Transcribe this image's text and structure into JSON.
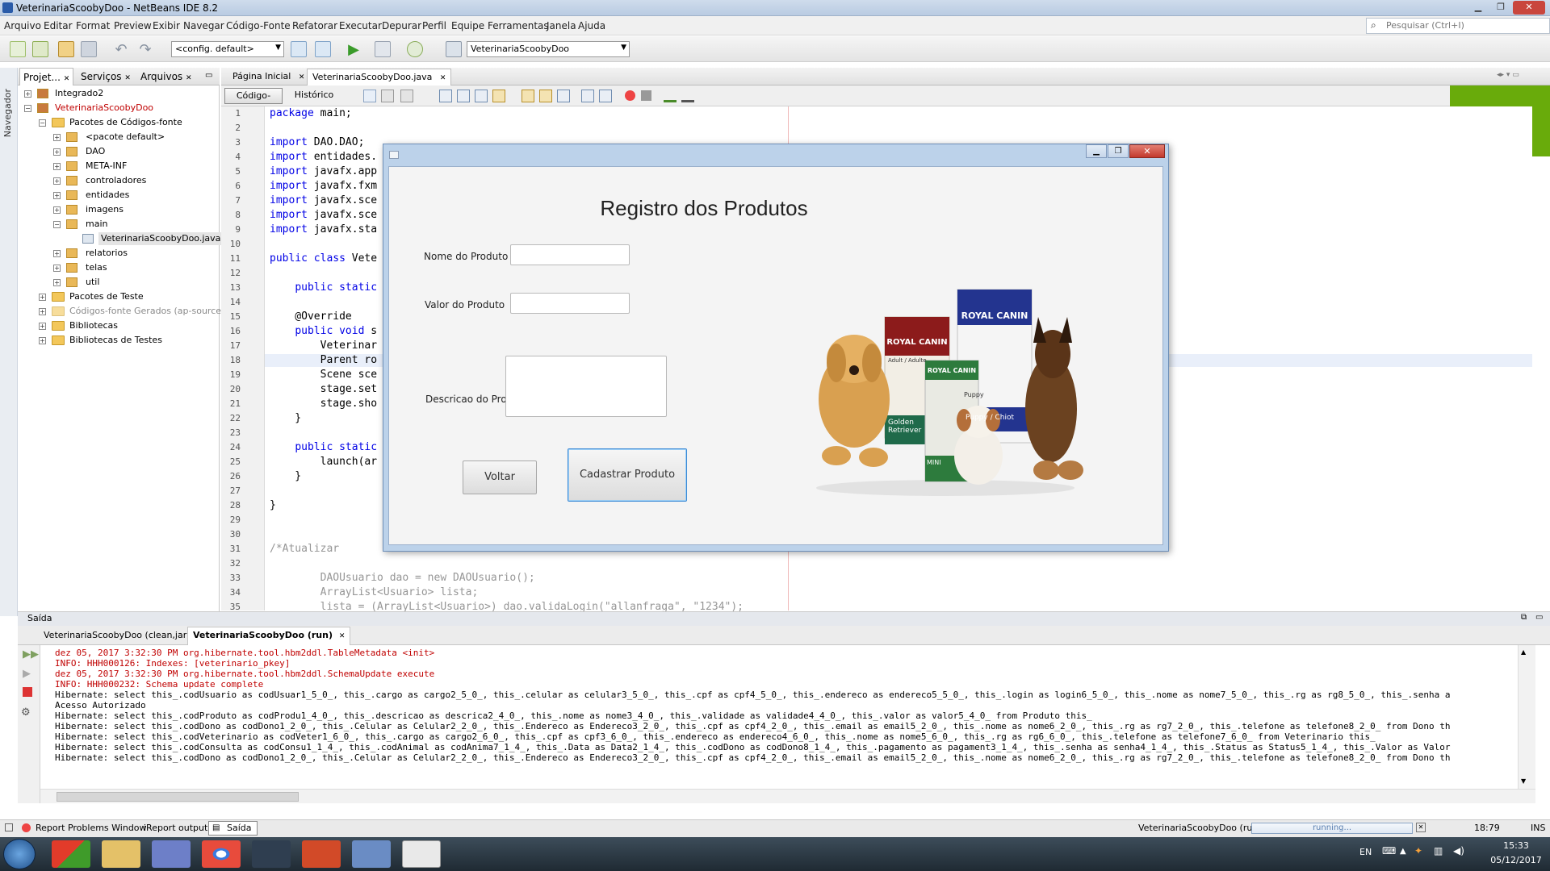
{
  "window": {
    "title": "VeterinariaScoobyDoo - NetBeans IDE 8.2"
  },
  "menu": [
    "Arquivo",
    "Editar",
    "Format",
    "Preview",
    "Exibir",
    "Navegar",
    "Código-Fonte",
    "Refatorar",
    "Executar",
    "Depurar",
    "Perfil",
    "Equipe",
    "Ferramentas",
    "Janela",
    "Ajuda"
  ],
  "search": {
    "placeholder": "Pesquisar (Ctrl+I)"
  },
  "toolbar": {
    "config_combo": "<config. default>",
    "project_combo": "VeterinariaScoobyDoo"
  },
  "navigator_label": "Navegador",
  "project_tabs": [
    "Projet...",
    "Serviços",
    "Arquivos"
  ],
  "tree": [
    {
      "label": "Integrado2"
    },
    {
      "label": "VeterinariaScoobyDoo"
    },
    {
      "label": "Pacotes de Códigos-fonte"
    },
    {
      "label": "<pacote default>"
    },
    {
      "label": "DAO"
    },
    {
      "label": "META-INF"
    },
    {
      "label": "controladores"
    },
    {
      "label": "entidades"
    },
    {
      "label": "imagens"
    },
    {
      "label": "main"
    },
    {
      "label": "VeterinariaScoobyDoo.java"
    },
    {
      "label": "relatorios"
    },
    {
      "label": "telas"
    },
    {
      "label": "util"
    },
    {
      "label": "Pacotes de Teste"
    },
    {
      "label": "Códigos-fonte Gerados (ap-source-out"
    },
    {
      "label": "Bibliotecas"
    },
    {
      "label": "Bibliotecas de Testes"
    }
  ],
  "editor_tabs": [
    "Página Inicial",
    "VeterinariaScoobyDoo.java"
  ],
  "editor_subtabs": [
    "Código-Fonte",
    "Histórico"
  ],
  "code_lines": [
    {
      "n": "1",
      "text": "package main;"
    },
    {
      "n": "2",
      "text": ""
    },
    {
      "n": "3",
      "text": "import DAO.DAO;"
    },
    {
      "n": "4",
      "text": "import entidades."
    },
    {
      "n": "5",
      "text": "import javafx.app"
    },
    {
      "n": "6",
      "text": "import javafx.fxm"
    },
    {
      "n": "7",
      "text": "import javafx.sce"
    },
    {
      "n": "8",
      "text": "import javafx.sce"
    },
    {
      "n": "9",
      "text": "import javafx.sta"
    },
    {
      "n": "10",
      "text": ""
    },
    {
      "n": "11",
      "text": "public class Vete"
    },
    {
      "n": "12",
      "text": ""
    },
    {
      "n": "13",
      "text": "    public static"
    },
    {
      "n": "14",
      "text": ""
    },
    {
      "n": "15",
      "text": "    @Override"
    },
    {
      "n": "16",
      "text": "    public void s"
    },
    {
      "n": "17",
      "text": "        Veterinar"
    },
    {
      "n": "18",
      "text": "        Parent ro"
    },
    {
      "n": "19",
      "text": "        Scene sce"
    },
    {
      "n": "20",
      "text": "        stage.set"
    },
    {
      "n": "21",
      "text": "        stage.sho"
    },
    {
      "n": "22",
      "text": "    }"
    },
    {
      "n": "23",
      "text": ""
    },
    {
      "n": "24",
      "text": "    public static"
    },
    {
      "n": "25",
      "text": "        launch(ar"
    },
    {
      "n": "26",
      "text": "    }"
    },
    {
      "n": "27",
      "text": ""
    },
    {
      "n": "28",
      "text": "}"
    },
    {
      "n": "29",
      "text": ""
    },
    {
      "n": "30",
      "text": ""
    },
    {
      "n": "31",
      "text": "/*Atualizar"
    },
    {
      "n": "32",
      "text": ""
    },
    {
      "n": "33",
      "text": "        DAOUsuario dao = new DAOUsuario();"
    },
    {
      "n": "34",
      "text": "        ArrayList<Usuario> lista;"
    },
    {
      "n": "35",
      "text": "        lista = (ArrayList<Usuario>) dao.validaLogin(\"allanfraga\", \"1234\");"
    }
  ],
  "dialog": {
    "title": "Registro dos Produtos",
    "label_nome": "Nome do Produto",
    "label_valor": "Valor do Produto",
    "label_descricao": "Descricao do Produto",
    "btn_voltar": "Voltar",
    "btn_cadastrar": "Cadastrar Produto",
    "brand": "ROYAL CANIN",
    "bag_labels": [
      "Golden Retriever",
      "Puppy / Chiot",
      "Puppy",
      "MINI",
      "Adult / Adulte"
    ]
  },
  "output": {
    "header": "Saída",
    "tabs": [
      "VeterinariaScoobyDoo (clean,jar)",
      "VeterinariaScoobyDoo (run)"
    ],
    "lines": [
      {
        "t": "dez 05, 2017 3:32:30 PM org.hibernate.tool.hbm2ddl.TableMetadata <init>",
        "red": true
      },
      {
        "t": "INFO: HHH000126: Indexes: [veterinario_pkey]",
        "red": true
      },
      {
        "t": "dez 05, 2017 3:32:30 PM org.hibernate.tool.hbm2ddl.SchemaUpdate execute",
        "red": true
      },
      {
        "t": "INFO: HHH000232: Schema update complete",
        "red": true
      },
      {
        "t": "Hibernate: select this_.codUsuario as codUsuar1_5_0_, this_.cargo as cargo2_5_0_, this_.celular as celular3_5_0_, this_.cpf as cpf4_5_0_, this_.endereco as endereco5_5_0_, this_.login as login6_5_0_, this_.nome as nome7_5_0_, this_.rg as rg8_5_0_, this_.senha a",
        "red": false
      },
      {
        "t": "Acesso Autorizado",
        "red": false
      },
      {
        "t": "Hibernate: select this_.codProduto as codProdu1_4_0_, this_.descricao as descrica2_4_0_, this_.nome as nome3_4_0_, this_.validade as validade4_4_0_, this_.valor as valor5_4_0_ from Produto this_",
        "red": false
      },
      {
        "t": "Hibernate: select this_.codDono as codDono1_2_0_, this_.Celular as Celular2_2_0_, this_.Endereco as Endereco3_2_0_, this_.cpf as cpf4_2_0_, this_.email as email5_2_0_, this_.nome as nome6_2_0_, this_.rg as rg7_2_0_, this_.telefone as telefone8_2_0_ from Dono th",
        "red": false
      },
      {
        "t": "Hibernate: select this_.codVeterinario as codVeter1_6_0_, this_.cargo as cargo2_6_0_, this_.cpf as cpf3_6_0_, this_.endereco as endereco4_6_0_, this_.nome as nome5_6_0_, this_.rg as rg6_6_0_, this_.telefone as telefone7_6_0_ from Veterinario this_",
        "red": false
      },
      {
        "t": "Hibernate: select this_.codConsulta as codConsu1_1_4_, this_.codAnimal as codAnima7_1_4_, this_.Data as Data2_1_4_, this_.codDono as codDono8_1_4_, this_.pagamento as pagament3_1_4_, this_.senha as senha4_1_4_, this_.Status as Status5_1_4_, this_.Valor as Valor",
        "red": false
      },
      {
        "t": "Hibernate: select this_.codDono as codDono1_2_0_, this_.Celular as Celular2_2_0_, this_.Endereco as Endereco3_2_0_, this_.cpf as cpf4_2_0_, this_.email as email5_2_0_, this_.nome as nome6_2_0_, this_.rg as rg7_2_0_, this_.telefone as telefone8_2_0_ from Dono th",
        "red": false
      }
    ]
  },
  "statusbar": {
    "items": [
      "Report Problems Window",
      "iReport output",
      "Saída"
    ],
    "run_label": "VeterinariaScoobyDoo (run)",
    "progress": "running...",
    "position": "18:79",
    "mode": "INS"
  },
  "taskbar": {
    "lang": "EN",
    "time": "15:33",
    "date": "05/12/2017"
  },
  "colors": {
    "accent_green": "#69ab0b",
    "keyword": "#0000e6",
    "error_red": "#c00000"
  }
}
